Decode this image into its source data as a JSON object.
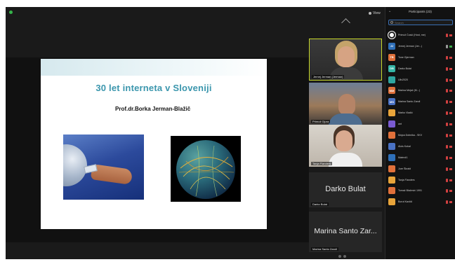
{
  "app": {
    "view_label": "View",
    "accent": "#c7d82a"
  },
  "stage": {
    "slide": {
      "title": "30 let interneta v Sloveniji",
      "subtitle": "Prof.dr.Borka Jerman-Blažič"
    }
  },
  "thumbnails": [
    {
      "name": "Jernej Jerman (Jerman)"
    },
    {
      "name": "Primož Gjura"
    },
    {
      "name": "Tanja Flanders"
    },
    {
      "name": "Darko Bulat",
      "big": "Darko Bulat"
    },
    {
      "name": "Marina Santo Zaroli",
      "big": "Marina Santo Zar..."
    }
  ],
  "panel": {
    "title": "Participants (23)",
    "search_placeholder": "Search",
    "participants": [
      {
        "initials": "",
        "name": "Primož Čosić (Host, me)",
        "color": "#ffffff"
      },
      {
        "initials": "JJ",
        "name": "Jernej Jerman (Jer...)",
        "color": "#2e6fb8"
      },
      {
        "initials": "TB",
        "name": "Tone Gjerman",
        "color": "#e0703a"
      },
      {
        "initials": "DB",
        "name": "Darko Bulat",
        "color": "#35b4a5"
      },
      {
        "initials": "",
        "name": "Ulix2020",
        "color": "#2fa6a0"
      },
      {
        "initials": "MM",
        "name": "Marina Mejač (Ki...)",
        "color": "#e0703a"
      },
      {
        "initials": "MS",
        "name": "Marina Santo Zaroli",
        "color": "#4a72c4"
      },
      {
        "initials": "",
        "name": "Marko Vladić",
        "color": "#e8a43a"
      },
      {
        "initials": "",
        "name": "ant",
        "color": "#7a5bd1"
      },
      {
        "initials": "",
        "name": "Mojca Dobnika - SKV",
        "color": "#e0703a"
      },
      {
        "initials": "",
        "name": "Alois Kokal",
        "color": "#4a72c4"
      },
      {
        "initials": "",
        "name": "Matevž1",
        "color": "#2e6fb8"
      },
      {
        "initials": "",
        "name": "Jure Škrabl",
        "color": "#e0703a"
      },
      {
        "initials": "",
        "name": "Tanja Flanders",
        "color": "#e8a43a"
      },
      {
        "initials": "",
        "name": "Tomaž Blažević 1991",
        "color": "#e0703a"
      },
      {
        "initials": "",
        "name": "Borut Kavčič",
        "color": "#e8a43a"
      }
    ]
  }
}
